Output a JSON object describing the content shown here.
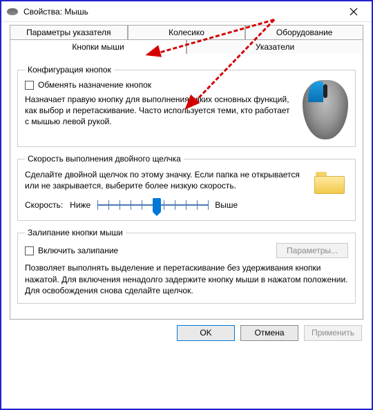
{
  "window": {
    "title": "Свойства: Мышь"
  },
  "tabs": {
    "row1": [
      {
        "label": "Параметры указателя"
      },
      {
        "label": "Колесико"
      },
      {
        "label": "Оборудование"
      }
    ],
    "row2": [
      {
        "label": "Кнопки мыши",
        "active": true
      },
      {
        "label": "Указатели"
      }
    ]
  },
  "config": {
    "legend": "Конфигурация кнопок",
    "swap_label": "Обменять назначение кнопок",
    "swap_checked": false,
    "desc": "Назначает правую кнопку для выполнения таких основных функций, как выбор и перетаскивание. Часто используется теми, кто работает с мышью левой рукой."
  },
  "doubleclick": {
    "legend": "Скорость выполнения двойного щелчка",
    "desc": "Сделайте двойной щелчок по этому значку. Если папка не открывается или не закрывается, выберите более низкую скорость.",
    "speed_label": "Скорость:",
    "low_label": "Ниже",
    "high_label": "Выше",
    "value": 5,
    "min": 0,
    "max": 10
  },
  "clicklock": {
    "legend": "Залипание кнопки мыши",
    "enable_label": "Включить залипание",
    "enable_checked": false,
    "params_button": "Параметры...",
    "desc": "Позволяет выполнять выделение и перетаскивание без удерживания кнопки нажатой. Для включения ненадолго задержите кнопку мыши в нажатом положении. Для освобождения снова сделайте щелчок."
  },
  "buttons": {
    "ok": "OK",
    "cancel": "Отмена",
    "apply": "Применить"
  }
}
